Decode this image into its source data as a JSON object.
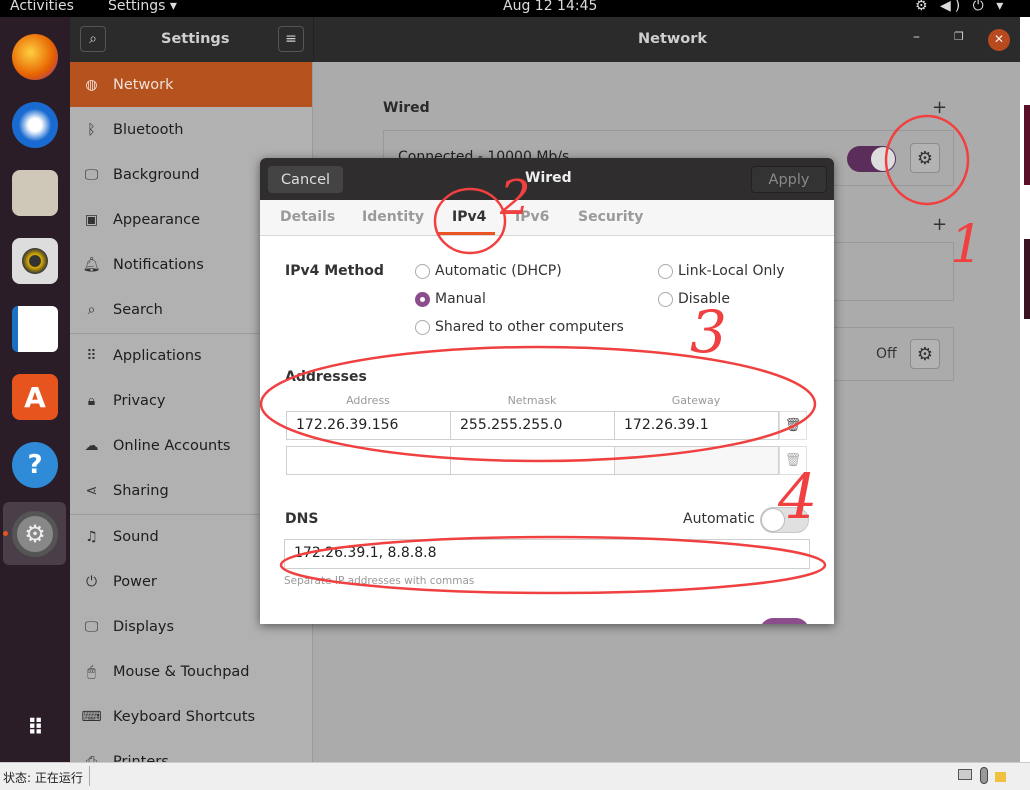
{
  "topbar": {
    "activities": "Activities",
    "app_menu": "Settings ▾",
    "clock": "Aug 12  14:45",
    "tray": "⚙ ◀) ⏻ ▾"
  },
  "dock": {
    "apps": [
      "firefox",
      "thunderbird",
      "files",
      "rhythmbox",
      "libreoffice-writer",
      "ubuntu-software",
      "help",
      "settings"
    ],
    "show_apps": "show-apps"
  },
  "window": {
    "sidebar_title": "Settings",
    "panel_title": "Network"
  },
  "sidebar": {
    "items": [
      {
        "label": "Network",
        "icon": "◍"
      },
      {
        "label": "Bluetooth",
        "icon": "ᛒ"
      },
      {
        "label": "Background",
        "icon": "🖵"
      },
      {
        "label": "Appearance",
        "icon": "▣"
      },
      {
        "label": "Notifications",
        "icon": "🔔︎"
      },
      {
        "label": "Search",
        "icon": "⌕"
      },
      {
        "label": "Applications",
        "icon": "⠿"
      },
      {
        "label": "Privacy",
        "icon": "🔒︎"
      },
      {
        "label": "Online Accounts",
        "icon": "☁"
      },
      {
        "label": "Sharing",
        "icon": "⋖"
      },
      {
        "label": "Sound",
        "icon": "♫"
      },
      {
        "label": "Power",
        "icon": "⏻"
      },
      {
        "label": "Displays",
        "icon": "🖵"
      },
      {
        "label": "Mouse & Touchpad",
        "icon": "🖱︎"
      },
      {
        "label": "Keyboard Shortcuts",
        "icon": "⌨"
      },
      {
        "label": "Printers",
        "icon": "⎙"
      }
    ]
  },
  "network": {
    "wired_heading": "Wired",
    "wired_status": "Connected - 10000 Mb/s",
    "wired_enabled": true,
    "proxy_status": "Off"
  },
  "dialog": {
    "title": "Wired",
    "cancel": "Cancel",
    "apply": "Apply",
    "tabs": [
      "Details",
      "Identity",
      "IPv4",
      "IPv6",
      "Security"
    ],
    "active_tab": "IPv4",
    "method_label": "IPv4 Method",
    "methods": [
      "Automatic (DHCP)",
      "Manual",
      "Shared to other computers",
      "Link-Local Only",
      "Disable"
    ],
    "selected_method": "Manual",
    "addresses_label": "Addresses",
    "columns": [
      "Address",
      "Netmask",
      "Gateway"
    ],
    "rows": [
      [
        "172.26.39.156",
        "255.255.255.0",
        "172.26.39.1"
      ],
      [
        "",
        "",
        ""
      ]
    ],
    "dns_label": "DNS",
    "dns_auto_label": "Automatic",
    "dns_auto": false,
    "dns_value": "172.26.39.1, 8.8.8.8",
    "dns_hint": "Separate IP addresses with commas"
  },
  "annotations": [
    "1",
    "2",
    "3",
    "4"
  ],
  "annotation_color": "#f04040",
  "statusbar": {
    "text": "状态: 正在运行"
  }
}
